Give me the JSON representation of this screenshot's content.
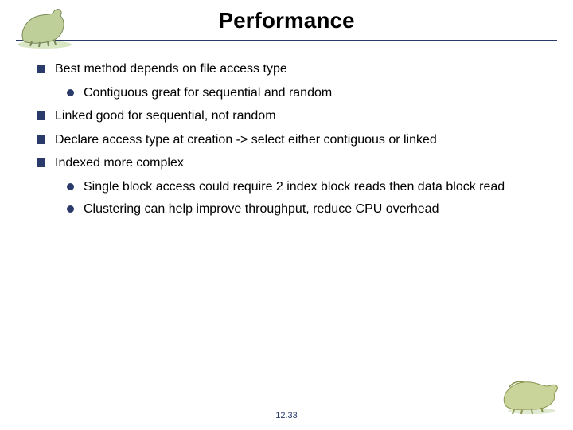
{
  "header": {
    "title": "Performance"
  },
  "content": {
    "items": [
      {
        "text": "Best method depends on file access type",
        "sub": [
          "Contiguous great for sequential and random"
        ]
      },
      {
        "text": "Linked good for sequential, not random",
        "sub": []
      },
      {
        "text": "Declare access type at creation -> select either contiguous or linked",
        "sub": []
      },
      {
        "text": "Indexed more complex",
        "sub": [
          "Single block access could require 2 index block reads then data block read",
          "Clustering can help improve throughput, reduce CPU overhead"
        ]
      }
    ]
  },
  "footer": {
    "page_number": "12.33"
  }
}
